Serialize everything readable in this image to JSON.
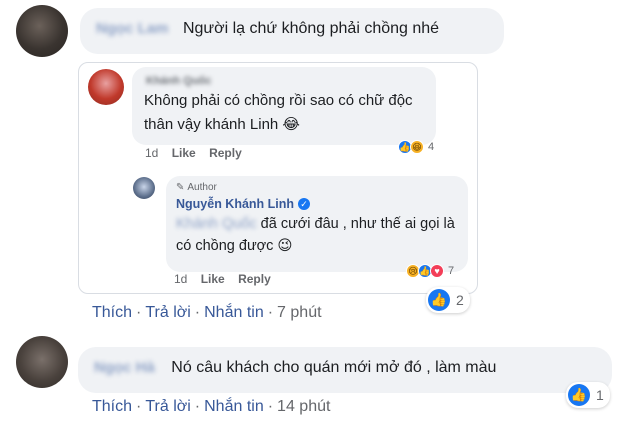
{
  "comment1": {
    "author": "Ngọc Lam",
    "text": "Người lạ chứ không phải chồng nhé",
    "actions": [
      "Thích",
      "Trả lời",
      "Nhắn tin"
    ],
    "time": "7 phút",
    "like_count": "2"
  },
  "reply1": {
    "author": "Khánh Quốc",
    "text": "Không phải có chồng rồi sao có chữ độc thân vậy khánh Linh 😂",
    "time": "1d",
    "like_label": "Like",
    "reply_label": "Reply",
    "reaction_count": "4"
  },
  "reply2": {
    "badge": "Author",
    "author": "Nguyễn Khánh Linh",
    "mention": "Khánh Quốc",
    "text": "đã cưới đâu , như thế ai gọi là có chồng được 😉",
    "time": "1d",
    "like_label": "Like",
    "reply_label": "Reply",
    "reaction_count": "7"
  },
  "comment2": {
    "author": "Ngọc Hà",
    "text": "Nó câu khách cho quán mới mở đó , làm màu",
    "actions": [
      "Thích",
      "Trả lời",
      "Nhắn tin"
    ],
    "time": "14 phút",
    "like_count": "1"
  },
  "icons": {
    "like": "thumbs-up-icon",
    "haha": "laugh-emoji-icon",
    "love": "heart-icon",
    "sad": "sad-emoji-icon",
    "verified": "verified-check-icon"
  },
  "colors": {
    "link": "#385898",
    "like_blue": "#1877f2",
    "bubble": "#f0f2f5"
  }
}
